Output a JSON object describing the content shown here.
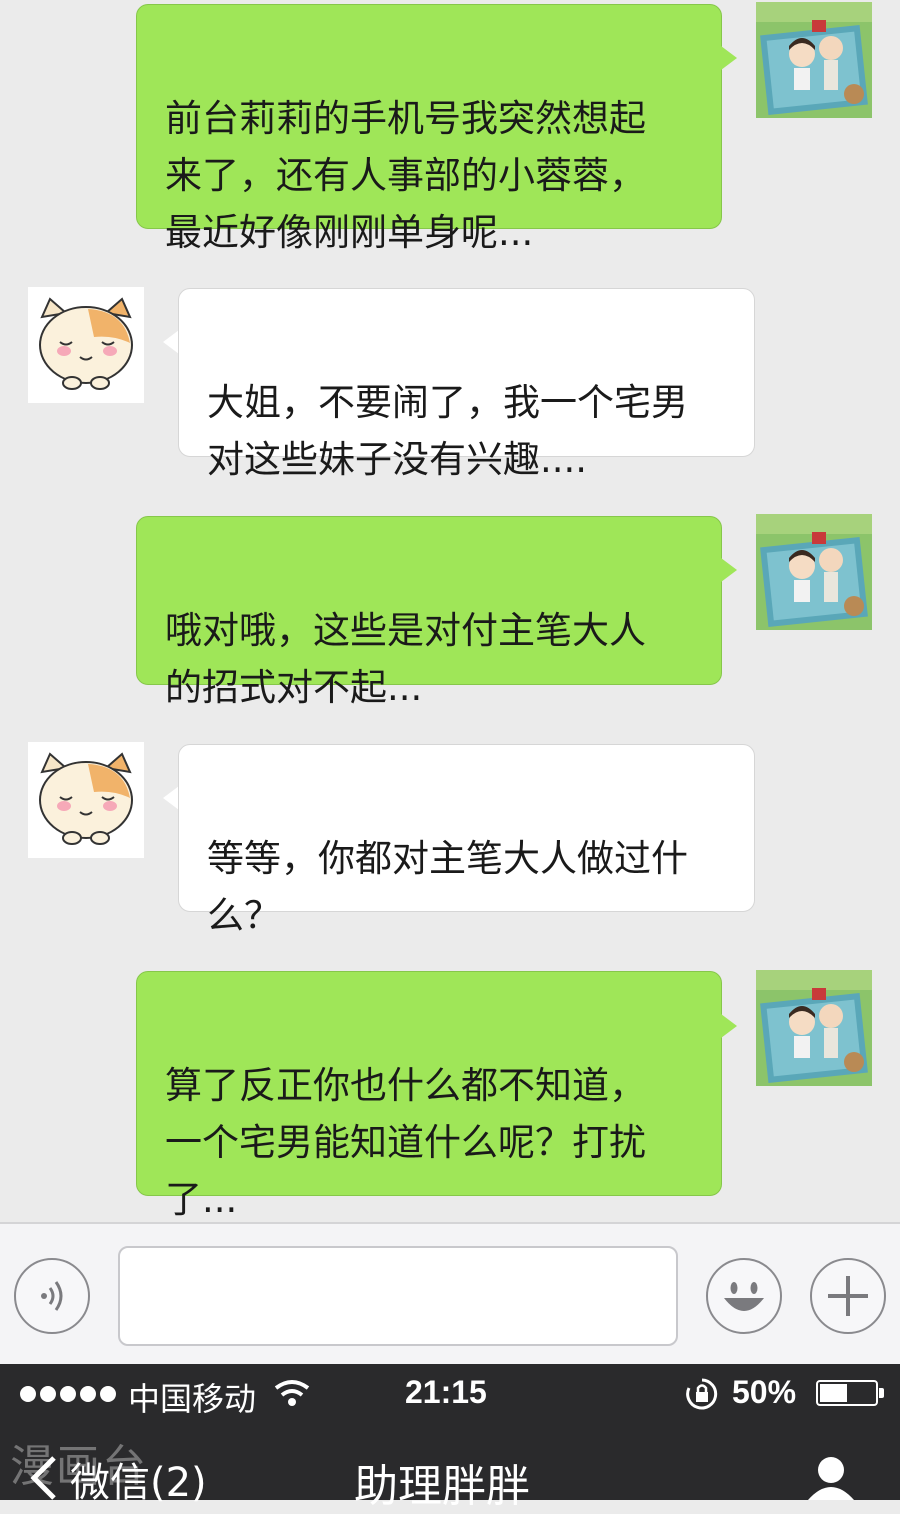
{
  "messages": [
    {
      "from": "me",
      "text": "前台莉莉的手机号我突然想起\n来了，还有人事部的小蓉蓉，\n最近好像刚刚单身呢..."
    },
    {
      "from": "them",
      "text": "大姐，不要闹了，我一个宅男\n对这些妹子没有兴趣...."
    },
    {
      "from": "me",
      "text": "哦对哦，这些是对付主笔大人\n的招式对不起..."
    },
    {
      "from": "them",
      "text": "等等，你都对主笔大人做过什\n么？"
    },
    {
      "from": "me",
      "text": "算了反正你也什么都不知道，\n一个宅男能知道什么呢？打扰\n了..."
    }
  ],
  "input": {
    "value": "",
    "placeholder": ""
  },
  "icons": {
    "voice": "voice-icon",
    "emoji": "emoji-icon",
    "add": "add-icon",
    "signal": "signal-dots-icon",
    "wifi": "wifi-icon",
    "lock": "rotation-lock-icon",
    "battery": "battery-icon",
    "back": "back-chevron-icon",
    "profile": "profile-icon"
  },
  "statusbar": {
    "carrier": "中国移动",
    "time": "21:15",
    "battery": "50%",
    "battery_level": 0.5
  },
  "navbar": {
    "back_label": "微信(2)",
    "title": "助理胖胖"
  },
  "watermark": "漫画台",
  "colors": {
    "my_bubble": "#9fe658",
    "their_bubble": "#ffffff",
    "chat_bg": "#ebebeb",
    "status_bg": "#2a2a2c"
  }
}
